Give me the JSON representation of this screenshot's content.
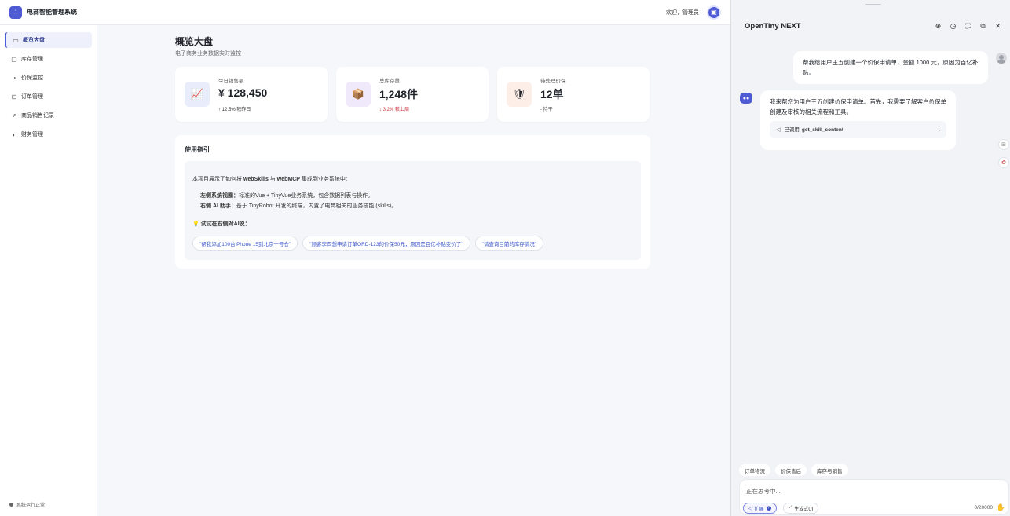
{
  "header": {
    "app_title": "电商智能管理系统",
    "logo_icon": "∴",
    "welcome": "欢迎，管理员",
    "avatar_icon": "▣"
  },
  "sidebar": {
    "items": [
      {
        "label": "概览大盘",
        "icon": "monitor-icon",
        "glyph": "▭",
        "active": true
      },
      {
        "label": "库存管理",
        "icon": "box-icon",
        "glyph": "▢",
        "active": false
      },
      {
        "label": "价保监控",
        "icon": "lock-icon",
        "glyph": "◔",
        "active": false
      },
      {
        "label": "订单管理",
        "icon": "cart-icon",
        "glyph": "⊡",
        "active": false
      },
      {
        "label": "商品销售记录",
        "icon": "chart-line-icon",
        "glyph": "↗",
        "active": false
      },
      {
        "label": "财务管理",
        "icon": "wallet-icon",
        "glyph": "◐",
        "active": false
      }
    ],
    "status_text": "系统运行正常"
  },
  "main": {
    "title": "概览大盘",
    "subtitle": "电子商务业务数据实时监控",
    "cards": [
      {
        "label": "今日销售额",
        "value": "¥ 128,450",
        "delta": "↑ 12.5% 较昨日",
        "delta_color": "#333333",
        "tile_bg": "#e8ecfb",
        "tile_glyph": "📈"
      },
      {
        "label": "总库存量",
        "value": "1,248件",
        "delta": "↓ 3.2% 较上周",
        "delta_color": "#d0323a",
        "tile_bg": "#efe9fb",
        "tile_glyph": "📦"
      },
      {
        "label": "待处理价保",
        "value": "12单",
        "delta": "- 持平",
        "delta_color": "#555555",
        "tile_bg": "#fdeee8",
        "tile_glyph": "🛡"
      }
    ],
    "guide": {
      "title": "使用指引",
      "intro_pre": "本项目展示了如何将 ",
      "intro_b1": "webSkills",
      "intro_mid": " 与 ",
      "intro_b2": "webMCP",
      "intro_post": " 集成到业务系统中：",
      "line1_label": "左侧系统视图：",
      "line1_text": "标准的Vue + TinyVue业务系统，包含数据列表与操作。",
      "line2_label": "右侧 AI 助手：",
      "line2_text": "基于 TinyRobot 开发的终端，内置了电商相关的业务技能 (skills)。",
      "try_label": "💡 试试在右侧对AI说：",
      "chips": [
        "\"帮我添加100台iPhone 15到北京一号仓\"",
        "\"顾客李四想申请订单ORD-123的价保50元，原因是百亿补贴变价了\"",
        "\"请查询目前的库存情况\""
      ]
    }
  },
  "chat": {
    "title": "OpenTiny NEXT",
    "tools": [
      {
        "name": "new-chat-icon",
        "glyph": "⊕"
      },
      {
        "name": "history-icon",
        "glyph": "◷"
      },
      {
        "name": "fullscreen-icon",
        "glyph": "⛶"
      },
      {
        "name": "popout-icon",
        "glyph": "⧉"
      },
      {
        "name": "close-icon",
        "glyph": "✕"
      }
    ],
    "user_message": "帮我给用户王五创建一个价保申请单，金额 1000 元，原因为百亿补贴。",
    "bot_message": "我来帮您为用户王五创建价保申请单。首先，我需要了解客户价保单创建及审核的相关流程和工具。",
    "tool_call_prefix": "已调用",
    "tool_call_name": "get_skill_content",
    "quick_actions": [
      "订单物流",
      "价保售后",
      "库存与销售"
    ],
    "input_placeholder": "正在思考中...",
    "expand_label": "扩展",
    "generate_label": "生成式UI",
    "counter": "0/20000"
  }
}
